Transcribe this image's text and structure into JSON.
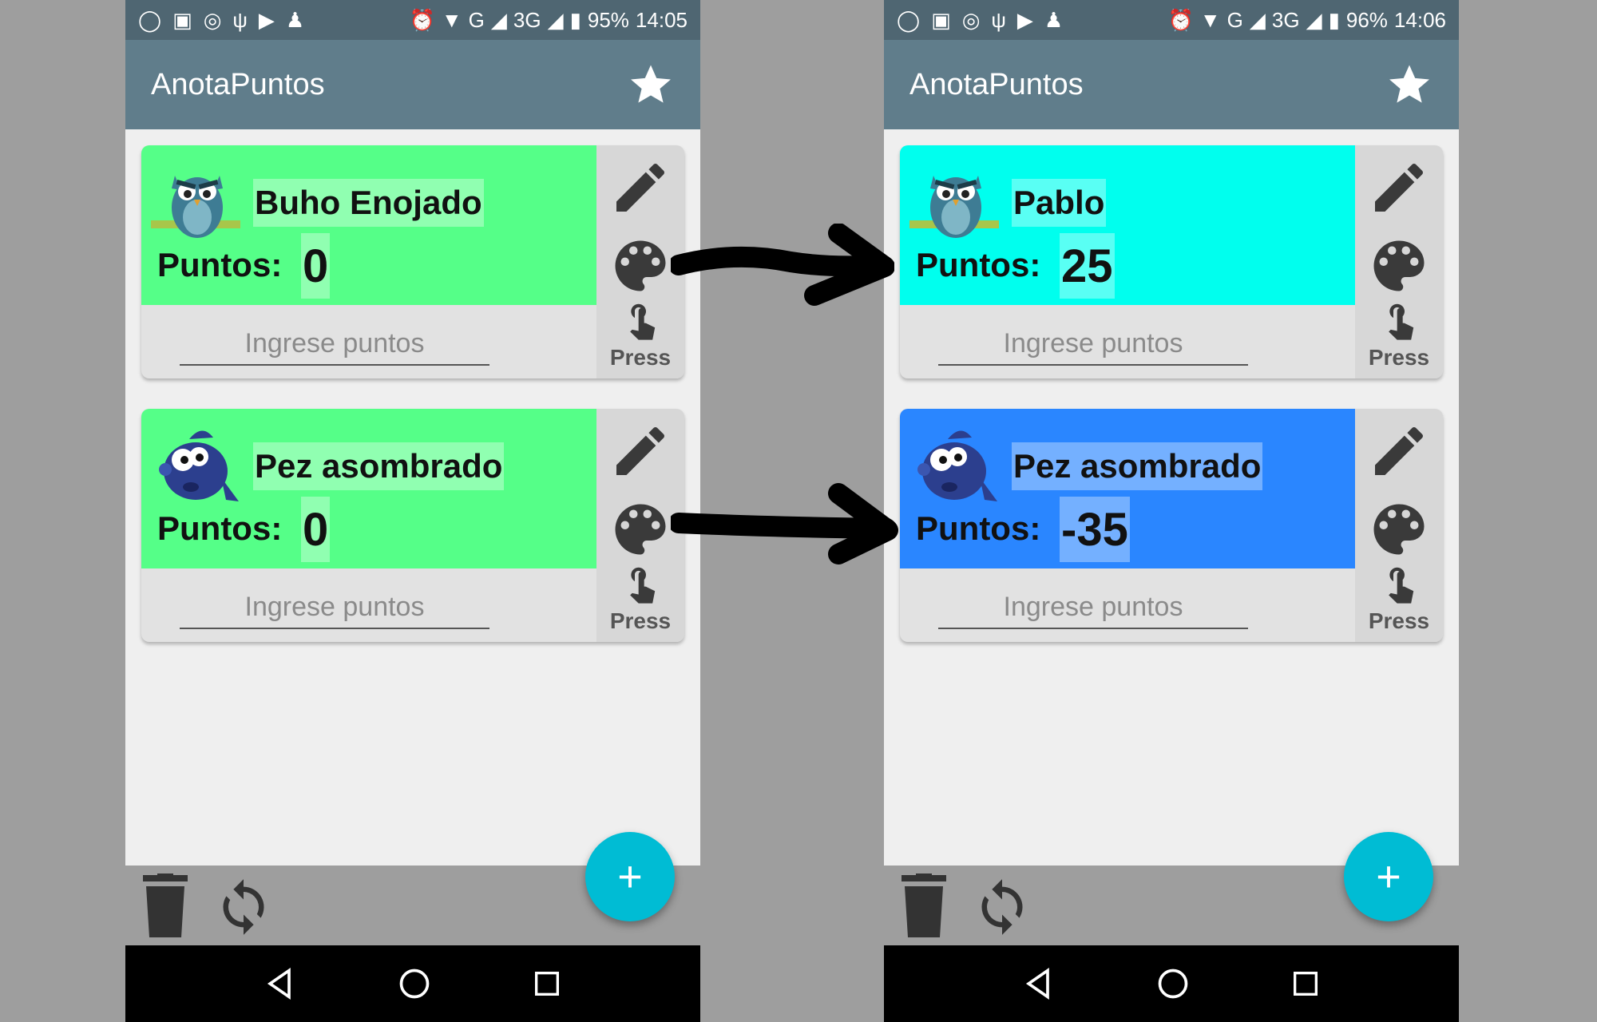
{
  "phones": [
    {
      "status": {
        "battery": "95%",
        "time": "14:05",
        "network": "G",
        "network2": "3G"
      },
      "app_title": "AnotaPuntos",
      "cards": [
        {
          "name": "Buho Enojado",
          "puntos_label": "Puntos:",
          "score": "0",
          "placeholder": "Ingrese puntos",
          "press": "Press",
          "color": "#55ff88",
          "avatar": "owl-icon"
        },
        {
          "name": "Pez asombrado",
          "puntos_label": "Puntos:",
          "score": "0",
          "placeholder": "Ingrese puntos",
          "press": "Press",
          "color": "#55ff88",
          "avatar": "fish-icon"
        }
      ],
      "fab": "+"
    },
    {
      "status": {
        "battery": "96%",
        "time": "14:06",
        "network": "G",
        "network2": "3G"
      },
      "app_title": "AnotaPuntos",
      "cards": [
        {
          "name": "Pablo",
          "puntos_label": "Puntos:",
          "score": "25",
          "placeholder": "Ingrese puntos",
          "press": "Press",
          "color": "#00ffee",
          "avatar": "owl-icon"
        },
        {
          "name": "Pez asombrado",
          "puntos_label": "Puntos:",
          "score": "-35",
          "placeholder": "Ingrese puntos",
          "press": "Press",
          "color": "#2a86ff",
          "avatar": "fish-icon"
        }
      ],
      "fab": "+"
    }
  ],
  "colors": {
    "app_bar": "#607d8b",
    "status_bar": "#4f6672",
    "fab": "#00bcd4"
  }
}
